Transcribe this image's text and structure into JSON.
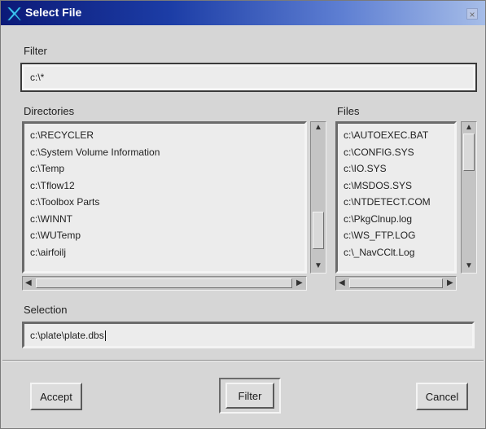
{
  "window": {
    "title": "Select File",
    "close_glyph": "×",
    "icon": "x-logo-icon"
  },
  "filter": {
    "label": "Filter",
    "value": "c:\\*"
  },
  "directories": {
    "label": "Directories",
    "items": [
      "c:\\RECYCLER",
      "c:\\System Volume Information",
      "c:\\Temp",
      "c:\\Tflow12",
      "c:\\Toolbox Parts",
      "c:\\WINNT",
      "c:\\WUTemp",
      "c:\\airfoilj"
    ]
  },
  "files": {
    "label": "Files",
    "items": [
      "c:\\AUTOEXEC.BAT",
      "c:\\CONFIG.SYS",
      "c:\\IO.SYS",
      "c:\\MSDOS.SYS",
      "c:\\NTDETECT.COM",
      "c:\\PkgClnup.log",
      "c:\\WS_FTP.LOG",
      "c:\\_NavCClt.Log"
    ]
  },
  "selection": {
    "label": "Selection",
    "value": "c:\\plate\\plate.dbs"
  },
  "buttons": {
    "accept": "Accept",
    "filter": "Filter",
    "cancel": "Cancel"
  },
  "colors": {
    "title_gradient_start": "#0c1a78",
    "title_gradient_end": "#a6bde8",
    "dialog_bg": "#d6d6d6",
    "field_bg": "#ececec"
  }
}
